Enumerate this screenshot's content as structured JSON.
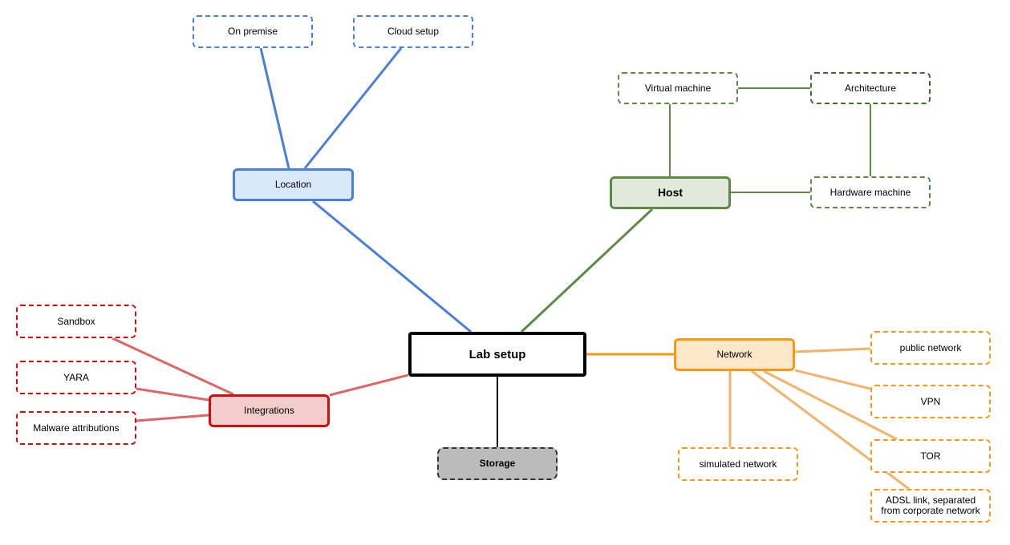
{
  "diagram": {
    "type": "mind-map",
    "root": {
      "id": "lab",
      "label": "Lab setup"
    },
    "colors": {
      "location": "#4a7fd9",
      "location_fill": "#dae8fc",
      "host": "#5d8a45",
      "host_fill": "#e1e9dc",
      "integrations": "#cc1111",
      "integrations_fill": "#f3cccc",
      "integrations_edge": "#dd6666",
      "network": "#f59a12",
      "network_fill": "#fde7c9",
      "network_edge": "#f4b26e",
      "storage_fill": "#bbbbbb",
      "storage_border": "#333333"
    },
    "nodes": {
      "lab": "Lab setup",
      "location": "Location",
      "on_premise": "On premise",
      "cloud_setup": "Cloud setup",
      "host": "Host",
      "virtual_machine": "Virtual machine",
      "architecture": "Architecture",
      "hardware_machine": "Hardware machine",
      "integrations": "Integrations",
      "sandbox": "Sandbox",
      "yara": "YARA",
      "malware_attributions": "Malware attributions",
      "storage": "Storage",
      "network": "Network",
      "public_network": "public network",
      "vpn": "VPN",
      "tor": "TOR",
      "adsl": "ADSL link, separated from corporate network",
      "simulated_network": "simulated network"
    },
    "edges": [
      [
        "lab",
        "location"
      ],
      [
        "location",
        "on_premise"
      ],
      [
        "location",
        "cloud_setup"
      ],
      [
        "lab",
        "host"
      ],
      [
        "host",
        "virtual_machine"
      ],
      [
        "host",
        "hardware_machine"
      ],
      [
        "virtual_machine",
        "architecture"
      ],
      [
        "architecture",
        "hardware_machine"
      ],
      [
        "lab",
        "integrations"
      ],
      [
        "integrations",
        "sandbox"
      ],
      [
        "integrations",
        "yara"
      ],
      [
        "integrations",
        "malware_attributions"
      ],
      [
        "lab",
        "storage"
      ],
      [
        "lab",
        "network"
      ],
      [
        "network",
        "public_network"
      ],
      [
        "network",
        "vpn"
      ],
      [
        "network",
        "tor"
      ],
      [
        "network",
        "adsl"
      ],
      [
        "network",
        "simulated_network"
      ]
    ]
  }
}
